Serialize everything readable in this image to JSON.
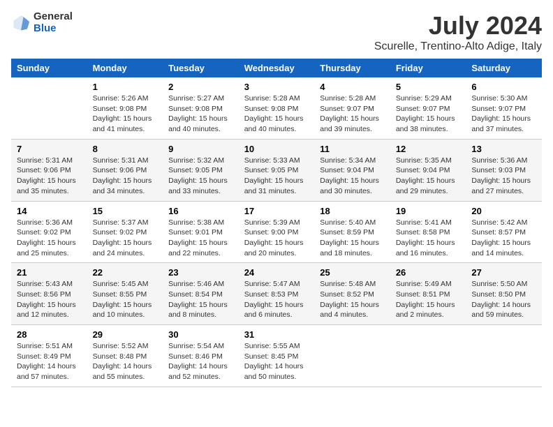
{
  "logo": {
    "general": "General",
    "blue": "Blue"
  },
  "title": "July 2024",
  "subtitle": "Scurelle, Trentino-Alto Adige, Italy",
  "days_header": [
    "Sunday",
    "Monday",
    "Tuesday",
    "Wednesday",
    "Thursday",
    "Friday",
    "Saturday"
  ],
  "weeks": [
    [
      {
        "num": "",
        "info": ""
      },
      {
        "num": "1",
        "info": "Sunrise: 5:26 AM\nSunset: 9:08 PM\nDaylight: 15 hours\nand 41 minutes."
      },
      {
        "num": "2",
        "info": "Sunrise: 5:27 AM\nSunset: 9:08 PM\nDaylight: 15 hours\nand 40 minutes."
      },
      {
        "num": "3",
        "info": "Sunrise: 5:28 AM\nSunset: 9:08 PM\nDaylight: 15 hours\nand 40 minutes."
      },
      {
        "num": "4",
        "info": "Sunrise: 5:28 AM\nSunset: 9:07 PM\nDaylight: 15 hours\nand 39 minutes."
      },
      {
        "num": "5",
        "info": "Sunrise: 5:29 AM\nSunset: 9:07 PM\nDaylight: 15 hours\nand 38 minutes."
      },
      {
        "num": "6",
        "info": "Sunrise: 5:30 AM\nSunset: 9:07 PM\nDaylight: 15 hours\nand 37 minutes."
      }
    ],
    [
      {
        "num": "7",
        "info": "Sunrise: 5:31 AM\nSunset: 9:06 PM\nDaylight: 15 hours\nand 35 minutes."
      },
      {
        "num": "8",
        "info": "Sunrise: 5:31 AM\nSunset: 9:06 PM\nDaylight: 15 hours\nand 34 minutes."
      },
      {
        "num": "9",
        "info": "Sunrise: 5:32 AM\nSunset: 9:05 PM\nDaylight: 15 hours\nand 33 minutes."
      },
      {
        "num": "10",
        "info": "Sunrise: 5:33 AM\nSunset: 9:05 PM\nDaylight: 15 hours\nand 31 minutes."
      },
      {
        "num": "11",
        "info": "Sunrise: 5:34 AM\nSunset: 9:04 PM\nDaylight: 15 hours\nand 30 minutes."
      },
      {
        "num": "12",
        "info": "Sunrise: 5:35 AM\nSunset: 9:04 PM\nDaylight: 15 hours\nand 29 minutes."
      },
      {
        "num": "13",
        "info": "Sunrise: 5:36 AM\nSunset: 9:03 PM\nDaylight: 15 hours\nand 27 minutes."
      }
    ],
    [
      {
        "num": "14",
        "info": "Sunrise: 5:36 AM\nSunset: 9:02 PM\nDaylight: 15 hours\nand 25 minutes."
      },
      {
        "num": "15",
        "info": "Sunrise: 5:37 AM\nSunset: 9:02 PM\nDaylight: 15 hours\nand 24 minutes."
      },
      {
        "num": "16",
        "info": "Sunrise: 5:38 AM\nSunset: 9:01 PM\nDaylight: 15 hours\nand 22 minutes."
      },
      {
        "num": "17",
        "info": "Sunrise: 5:39 AM\nSunset: 9:00 PM\nDaylight: 15 hours\nand 20 minutes."
      },
      {
        "num": "18",
        "info": "Sunrise: 5:40 AM\nSunset: 8:59 PM\nDaylight: 15 hours\nand 18 minutes."
      },
      {
        "num": "19",
        "info": "Sunrise: 5:41 AM\nSunset: 8:58 PM\nDaylight: 15 hours\nand 16 minutes."
      },
      {
        "num": "20",
        "info": "Sunrise: 5:42 AM\nSunset: 8:57 PM\nDaylight: 15 hours\nand 14 minutes."
      }
    ],
    [
      {
        "num": "21",
        "info": "Sunrise: 5:43 AM\nSunset: 8:56 PM\nDaylight: 15 hours\nand 12 minutes."
      },
      {
        "num": "22",
        "info": "Sunrise: 5:45 AM\nSunset: 8:55 PM\nDaylight: 15 hours\nand 10 minutes."
      },
      {
        "num": "23",
        "info": "Sunrise: 5:46 AM\nSunset: 8:54 PM\nDaylight: 15 hours\nand 8 minutes."
      },
      {
        "num": "24",
        "info": "Sunrise: 5:47 AM\nSunset: 8:53 PM\nDaylight: 15 hours\nand 6 minutes."
      },
      {
        "num": "25",
        "info": "Sunrise: 5:48 AM\nSunset: 8:52 PM\nDaylight: 15 hours\nand 4 minutes."
      },
      {
        "num": "26",
        "info": "Sunrise: 5:49 AM\nSunset: 8:51 PM\nDaylight: 15 hours\nand 2 minutes."
      },
      {
        "num": "27",
        "info": "Sunrise: 5:50 AM\nSunset: 8:50 PM\nDaylight: 14 hours\nand 59 minutes."
      }
    ],
    [
      {
        "num": "28",
        "info": "Sunrise: 5:51 AM\nSunset: 8:49 PM\nDaylight: 14 hours\nand 57 minutes."
      },
      {
        "num": "29",
        "info": "Sunrise: 5:52 AM\nSunset: 8:48 PM\nDaylight: 14 hours\nand 55 minutes."
      },
      {
        "num": "30",
        "info": "Sunrise: 5:54 AM\nSunset: 8:46 PM\nDaylight: 14 hours\nand 52 minutes."
      },
      {
        "num": "31",
        "info": "Sunrise: 5:55 AM\nSunset: 8:45 PM\nDaylight: 14 hours\nand 50 minutes."
      },
      {
        "num": "",
        "info": ""
      },
      {
        "num": "",
        "info": ""
      },
      {
        "num": "",
        "info": ""
      }
    ]
  ]
}
